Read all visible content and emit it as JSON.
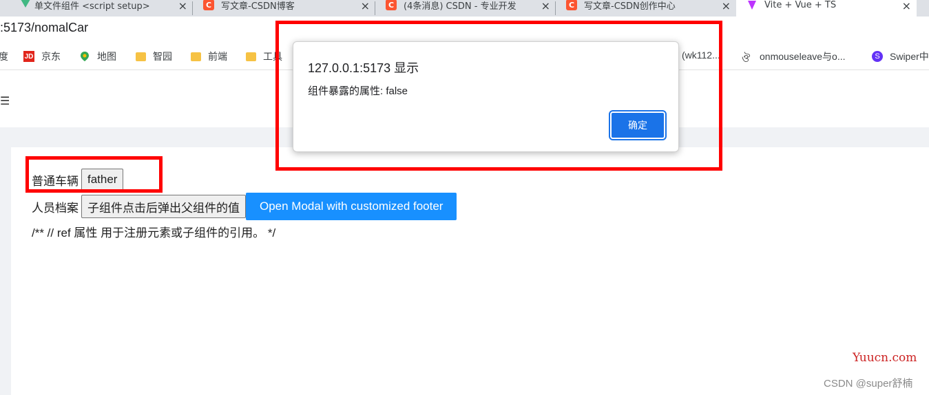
{
  "browser": {
    "tabs": [
      {
        "title": "单文件组件 <script setup>",
        "favicon": "vue-icon"
      },
      {
        "title": "写文章-CSDN博客",
        "favicon": "csdn-icon"
      },
      {
        "title": "(4条消息) CSDN - 专业开发",
        "favicon": "csdn-icon"
      },
      {
        "title": "写文章-CSDN创作中心",
        "favicon": "csdn-icon"
      },
      {
        "title": "Vite + Vue + TS",
        "favicon": "vite-icon"
      }
    ],
    "close_glyph": "×",
    "url": ":5173/nomalCar",
    "bookmarks": [
      {
        "label": "度",
        "icon": "baidu-icon"
      },
      {
        "label": "京东",
        "icon": "jd-icon"
      },
      {
        "label": "地图",
        "icon": "map-icon"
      },
      {
        "label": "智园",
        "icon": "folder-icon"
      },
      {
        "label": "前端",
        "icon": "folder-icon"
      },
      {
        "label": "工具",
        "icon": "folder-icon"
      },
      {
        "label": "(wk112...",
        "icon": "page-icon"
      },
      {
        "label": "onmouseleave与o...",
        "icon": "page-icon"
      },
      {
        "label": "Swiper中",
        "icon": "swiper-icon"
      }
    ]
  },
  "app": {
    "menu_glyph": "☰",
    "row1": {
      "label": "普通车辆",
      "button": "father"
    },
    "row2": {
      "label": "人员档案",
      "button": "子组件点击后弹出父组件的值",
      "primary_button": "Open Modal with customized footer"
    },
    "comment": "/** // ref 属性 用于注册元素或子组件的引用。 */"
  },
  "dialog": {
    "origin": "127.0.0.1:5173 显示",
    "message": "组件暴露的属性: false",
    "ok_label": "确定"
  },
  "watermarks": {
    "site": "Yuucn.com",
    "author": "CSDN @super舒楠"
  },
  "colors": {
    "primary": "#1890ff",
    "dialog_button": "#1a73e8",
    "annotation": "#ff0000"
  }
}
